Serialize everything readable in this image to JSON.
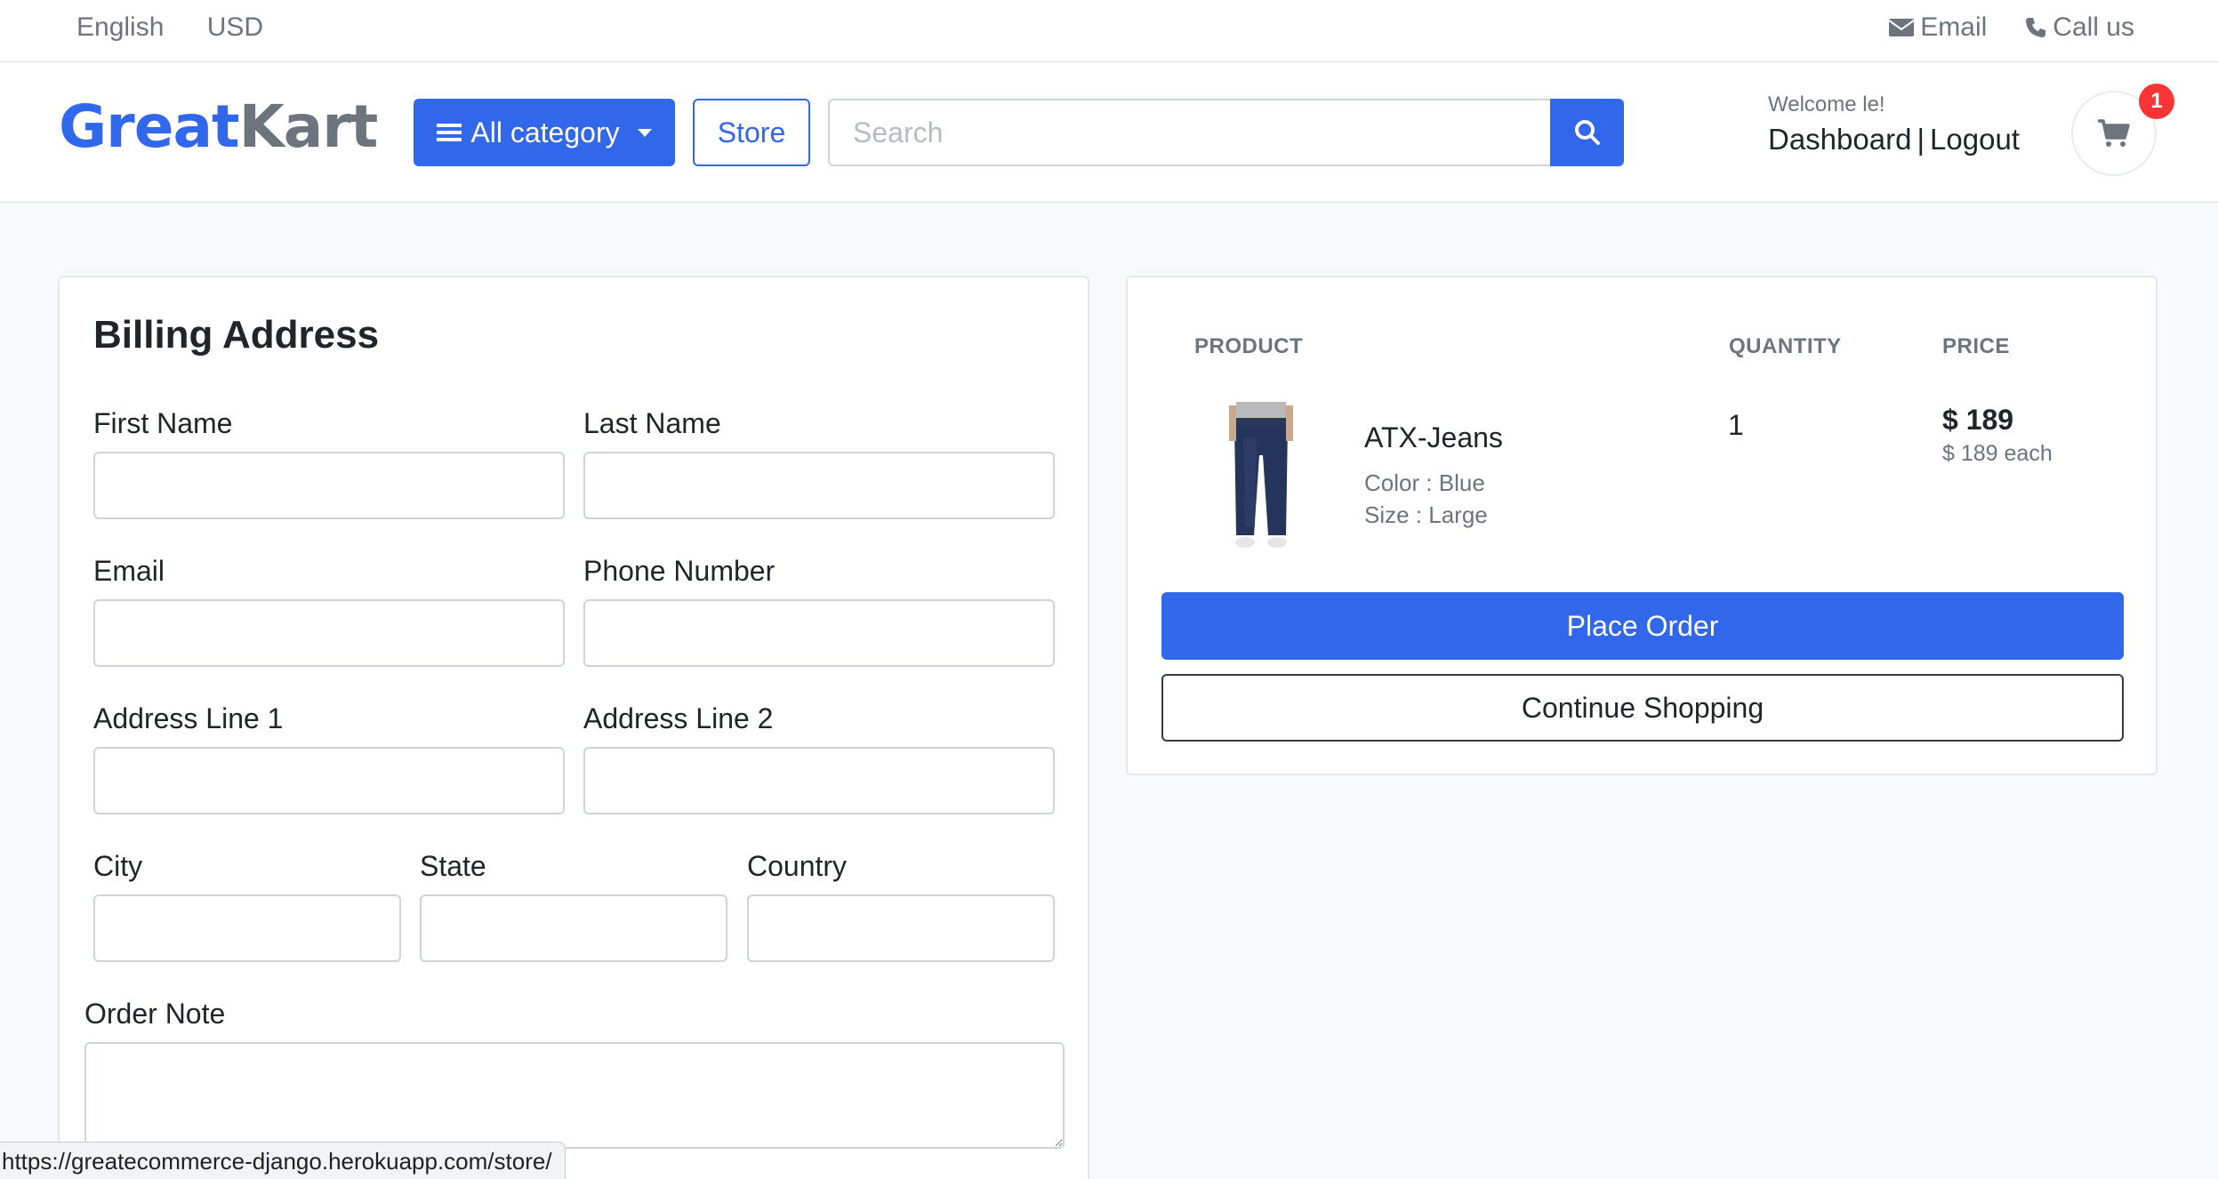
{
  "topbar": {
    "language": "English",
    "currency": "USD",
    "email_label": "Email",
    "call_label": "Call us"
  },
  "header": {
    "logo_part1": "Great",
    "logo_part2": "Kart",
    "category_button": "All category",
    "store_button": "Store",
    "search_placeholder": "Search",
    "welcome_text": "Welcome le!",
    "dashboard_link": "Dashboard",
    "separator": "|",
    "logout_link": "Logout",
    "cart_count": "1"
  },
  "billing": {
    "title": "Billing Address",
    "fields": {
      "first_name": "First Name",
      "last_name": "Last Name",
      "email": "Email",
      "phone": "Phone Number",
      "address1": "Address Line 1",
      "address2": "Address Line 2",
      "city": "City",
      "state": "State",
      "country": "Country",
      "order_note": "Order Note"
    }
  },
  "order": {
    "columns": {
      "product": "PRODUCT",
      "quantity": "QUANTITY",
      "price": "PRICE"
    },
    "item": {
      "name": "ATX-Jeans",
      "color": "Color : Blue",
      "size": "Size : Large",
      "quantity": "1",
      "price": "$ 189",
      "price_each": "$ 189 each"
    },
    "place_order_button": "Place Order",
    "continue_button": "Continue Shopping"
  },
  "status_bar": {
    "url": "https://greatecommerce-django.herokuapp.com/store/"
  },
  "colors": {
    "primary": "#3167eb",
    "badge": "#fa3434",
    "background": "#f8f9fa"
  }
}
